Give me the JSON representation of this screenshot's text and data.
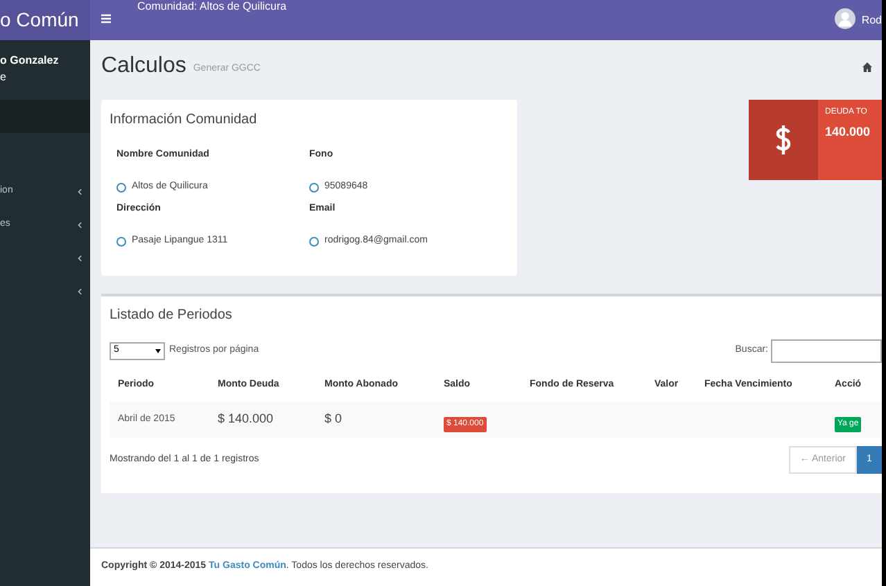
{
  "sidebar": {
    "logo": "o Común",
    "user_name": "o Gonzalez",
    "user_status": "e",
    "items": [
      {
        "kind": "link",
        "selected": true
      },
      {
        "kind": "submenu",
        "label": "ion",
        "selected": false
      },
      {
        "kind": "submenu",
        "label": "es",
        "selected": false
      },
      {
        "kind": "submenu",
        "selected": false
      },
      {
        "kind": "submenu",
        "selected": false
      }
    ]
  },
  "header": {
    "community": "Comunidad: Altos de Quilicura",
    "user": "Rod"
  },
  "page": {
    "title": "Calculos",
    "subtitle": "Generar GGCC"
  },
  "info_card": {
    "title": "Información Comunidad",
    "fields": [
      {
        "label": "Nombre Comunidad",
        "value": "Altos de Quilicura"
      },
      {
        "label": "Fono",
        "value": "95089648"
      },
      {
        "label": "Dirección",
        "value": "Pasaje Lipangue 1311"
      },
      {
        "label": "Email",
        "value": "rodrigog.84@gmail.com"
      }
    ]
  },
  "stat": {
    "label": "DEUDA TO",
    "value": "140.000"
  },
  "periods": {
    "title": "Listado de Periodos",
    "page_size": "5",
    "page_size_label": "Registros por página",
    "search_label": "Buscar:",
    "columns": [
      "Periodo",
      "Monto Deuda",
      "Monto Abonado",
      "Saldo",
      "Fondo de Reserva",
      "Valor",
      "Fecha Vencimiento",
      "Acció"
    ],
    "rows": [
      {
        "cells": [
          {
            "kind": "text",
            "text": "Abril de 2015"
          },
          {
            "kind": "amount",
            "text": "$ 140.000"
          },
          {
            "kind": "amount",
            "text": "$ 0"
          },
          {
            "kind": "badge",
            "text": "$ 140.000",
            "color": "#dd4b39"
          },
          {
            "kind": "empty"
          },
          {
            "kind": "empty"
          },
          {
            "kind": "empty"
          },
          {
            "kind": "badge",
            "text": "Ya ge",
            "color": "#00a65a"
          }
        ]
      }
    ],
    "summary": "Mostrando del 1 al 1 de 1 registros",
    "previous": "← Anterior",
    "pages": [
      {
        "label": "1",
        "selected": true
      }
    ]
  },
  "footer": {
    "copyright": "Copyright © 2014-2015",
    "link": "Tu Gasto Común",
    "rest": ". Todos los derechos reservados."
  }
}
